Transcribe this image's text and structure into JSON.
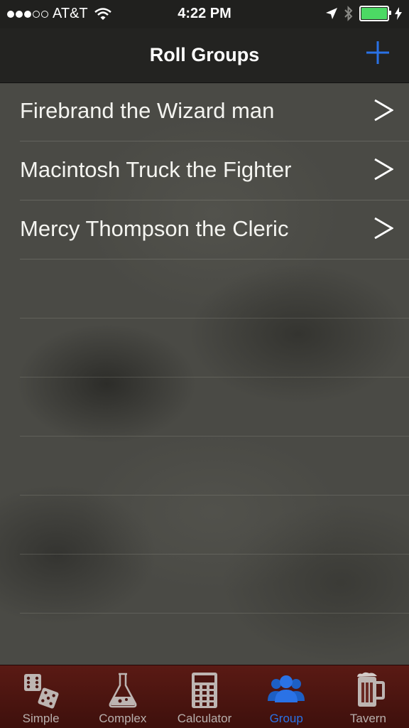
{
  "status_bar": {
    "carrier": "AT&T",
    "time": "4:22 PM",
    "battery_color": "#4cd964"
  },
  "nav": {
    "title": "Roll Groups",
    "add_icon": "plus-icon",
    "accent_color": "#2a72e6"
  },
  "groups": [
    {
      "label": "Firebrand the Wizard man"
    },
    {
      "label": "Macintosh Truck the Fighter"
    },
    {
      "label": "Mercy Thompson the Cleric"
    }
  ],
  "tabs": [
    {
      "label": "Simple",
      "icon": "dice-icon",
      "active": false
    },
    {
      "label": "Complex",
      "icon": "flask-icon",
      "active": false
    },
    {
      "label": "Calculator",
      "icon": "calculator-icon",
      "active": false
    },
    {
      "label": "Group",
      "icon": "group-icon",
      "active": true
    },
    {
      "label": "Tavern",
      "icon": "beer-mug-icon",
      "active": false
    }
  ]
}
